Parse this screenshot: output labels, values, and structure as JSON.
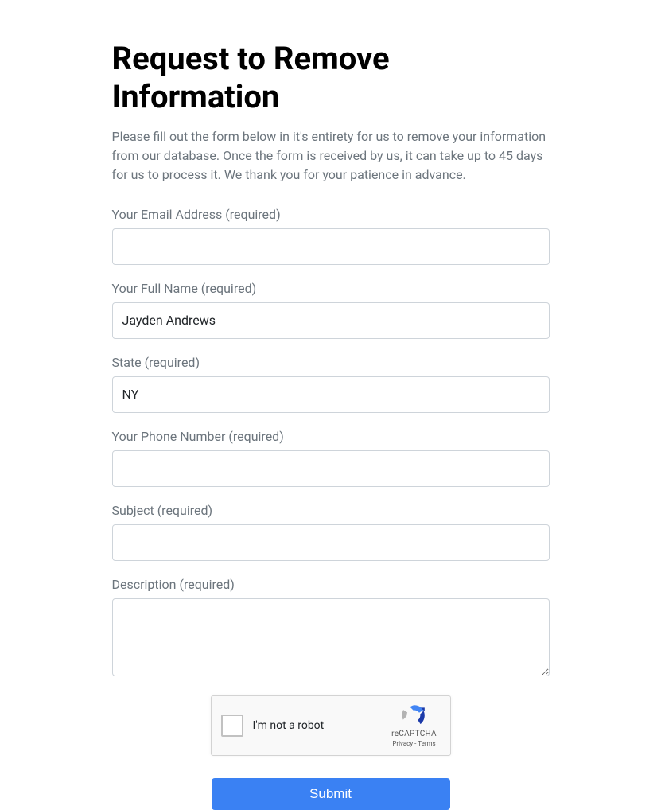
{
  "heading": "Request to Remove Information",
  "intro": "Please fill out the form below in it's entirety for us to remove your information from our database. Once the form is received by us, it can take up to 45 days for us to process it. We thank you for your patience in advance.",
  "fields": {
    "email": {
      "label": "Your Email Address (required)",
      "value": ""
    },
    "fullname": {
      "label": "Your Full Name (required)",
      "value": "Jayden Andrews"
    },
    "state": {
      "label": "State (required)",
      "value": "NY"
    },
    "phone": {
      "label": "Your Phone Number (required)",
      "value": ""
    },
    "subject": {
      "label": "Subject (required)",
      "value": ""
    },
    "description": {
      "label": "Description (required)",
      "value": ""
    }
  },
  "recaptcha": {
    "label": "I'm not a robot",
    "brand": "reCAPTCHA",
    "privacy": "Privacy",
    "separator": " - ",
    "terms": "Terms"
  },
  "submit_label": "Submit"
}
